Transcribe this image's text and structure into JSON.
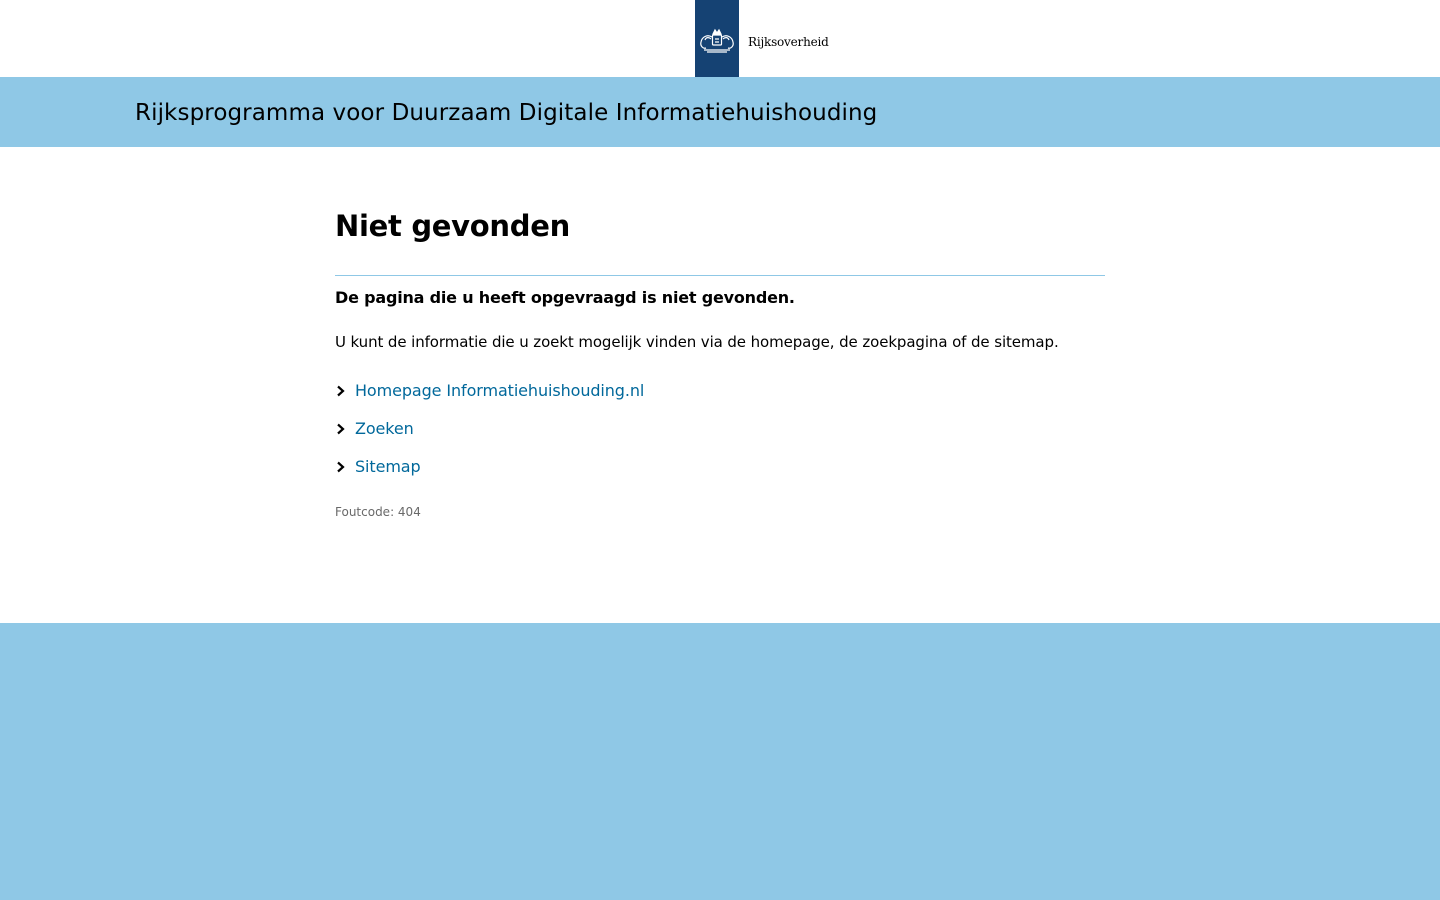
{
  "header": {
    "logo_icon": "crest-icon",
    "logo_text": "Rijksoverheid",
    "brand_color": "#154273"
  },
  "banner": {
    "site_title": "Rijksprogramma voor Duurzaam Digitale Informatiehuishouding",
    "color": "#8fc8e6"
  },
  "main": {
    "title": "Niet gevonden",
    "lead": "De pagina die u heeft opgevraagd is niet gevonden.",
    "body": "U kunt de informatie die u zoekt mogelijk vinden via de homepage, de zoekpagina of de sitemap.",
    "links": [
      {
        "label": "Homepage Informatiehuishouding.nl",
        "icon": "chevron-right-icon"
      },
      {
        "label": "Zoeken",
        "icon": "chevron-right-icon"
      },
      {
        "label": "Sitemap",
        "icon": "chevron-right-icon"
      }
    ],
    "link_color": "#01689b",
    "error_code": "Foutcode: 404"
  },
  "footer": {
    "color": "#8fc8e6"
  }
}
